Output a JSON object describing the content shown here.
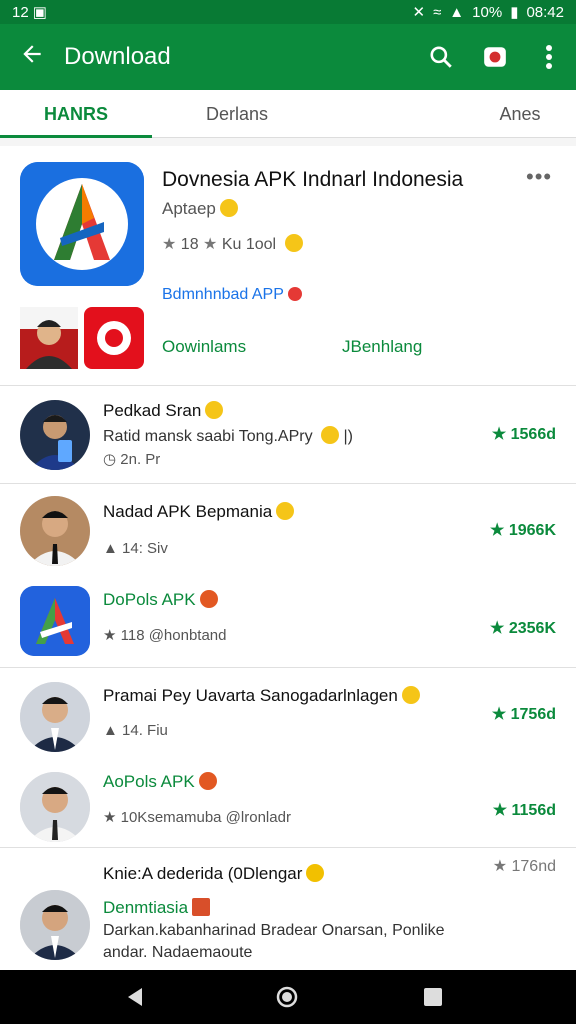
{
  "status": {
    "time": "12",
    "battery": "10%",
    "clock": "08:42"
  },
  "appbar": {
    "title": "Download"
  },
  "tabs": [
    {
      "label": "HANRS"
    },
    {
      "label": "Derlans"
    },
    {
      "label": "Anes"
    }
  ],
  "featured": {
    "title": "Dovnesia APK Indnarl Indonesia",
    "subtitle": "Aptaep",
    "rating": "18",
    "rating_extra": "Ku 1ool",
    "link": "Bdmnhnbad APP",
    "button_left": "Oowinlams",
    "button_right": "JBenhlang"
  },
  "rows": [
    {
      "title": "Pedkad Sran",
      "desc": "Ratid mansk saabi Tong.APry",
      "desc_tail": "|)",
      "meta": "2n. Pr",
      "size": "1566d"
    },
    {
      "title": "Nadad APK Bepmania",
      "meta": "14: Siv",
      "size": "1966K"
    },
    {
      "title": "DoPols APK",
      "meta": "118 @honbtand",
      "size": "2356K"
    },
    {
      "title": "Pramai Pey Uavarta Sanogadarlnlagen",
      "meta": "14. Fiu",
      "size": "1756d"
    },
    {
      "title": "AoPols APK",
      "meta": "10Ksemamuba @lronladr",
      "size": "1156d"
    },
    {
      "header": "Knie:A dederida (0Dlengar",
      "title": "Denmtiasia",
      "desc": "Darkan.kabanharinad Bradear Onarsan, Ponlike",
      "desc2": "andar. Nadaemaoute",
      "size": "176nd"
    }
  ],
  "colors": {
    "primary": "#0b8a3c",
    "link": "#1a73e8"
  },
  "icons": [
    "back-arrow-icon",
    "search-icon",
    "flag-icon",
    "more-vert-icon",
    "star-icon",
    "thumb-icon",
    "back-icon",
    "home-icon",
    "recents-icon"
  ]
}
